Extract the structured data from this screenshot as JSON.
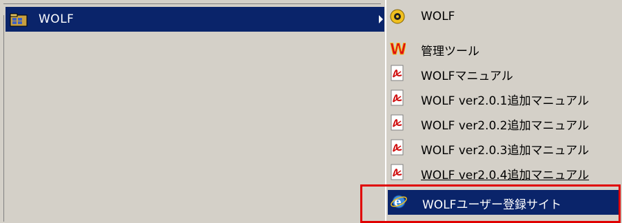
{
  "left_menu": {
    "item_label": "WOLF"
  },
  "submenu": {
    "items": [
      {
        "label": "WOLF",
        "icon": "wolf-app-icon"
      },
      {
        "label": "管理ツール",
        "icon": "w-admin-icon"
      },
      {
        "label": "WOLFマニュアル",
        "icon": "pdf-icon"
      },
      {
        "label": "WOLF ver2.0.1追加マニュアル",
        "icon": "pdf-icon"
      },
      {
        "label": "WOLF ver2.0.2追加マニュアル",
        "icon": "pdf-icon"
      },
      {
        "label": "WOLF ver2.0.3追加マニュアル",
        "icon": "pdf-icon"
      },
      {
        "label": "WOLF ver2.0.4追加マニュアル",
        "icon": "pdf-icon"
      },
      {
        "label": "WOLFユーザー登録サイト",
        "icon": "internet-explorer-icon"
      }
    ]
  },
  "colors": {
    "menu_bg": "#d4d0c8",
    "highlight_bg": "#0a246a",
    "annotation_red": "#e00000"
  }
}
